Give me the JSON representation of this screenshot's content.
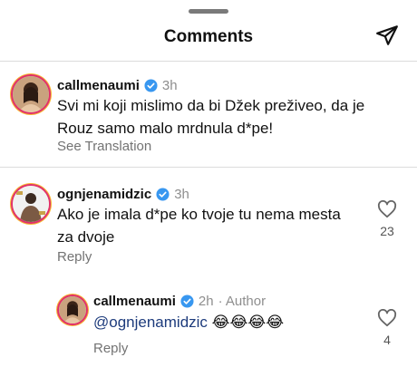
{
  "header": {
    "title": "Comments",
    "send_icon": "paper-plane-icon"
  },
  "comments": [
    {
      "username": "callmenaumi",
      "verified": true,
      "time": "3h",
      "text": "Svi mi koji mislimo da bi Džek preživeo, da je Rouz samo malo mrdnula d*pe!",
      "action": "See Translation"
    },
    {
      "username": "ognjenamidzic",
      "verified": true,
      "time": "3h",
      "text": "Ako je imala d*pe ko tvoje tu nema mesta za dvoje",
      "action": "Reply",
      "likes": "23"
    },
    {
      "username": "callmenaumi",
      "verified": true,
      "time": "2h",
      "author_label": "· Author",
      "mention": "@ognjenamidzic",
      "emojis": "😂😂😂😂",
      "action": "Reply",
      "likes": "4"
    }
  ],
  "colors": {
    "verified": "#3897f0",
    "mention": "#1d3b7c",
    "muted": "#737373"
  }
}
